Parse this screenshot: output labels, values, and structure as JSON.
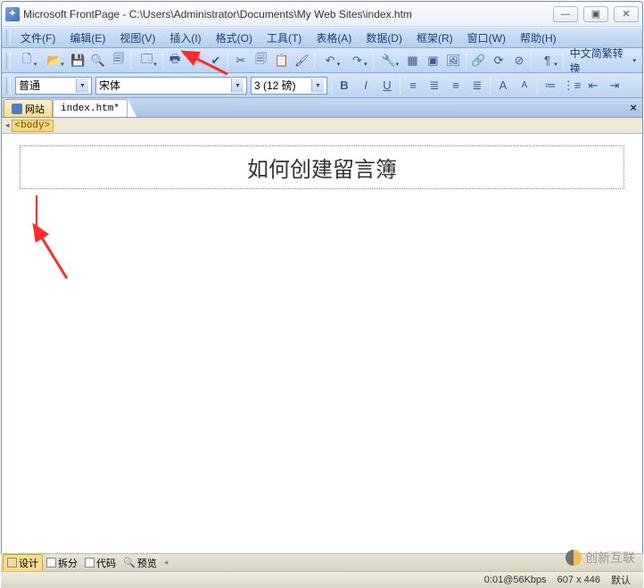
{
  "window": {
    "title": "Microsoft FrontPage - C:\\Users\\Administrator\\Documents\\My Web Sites\\index.htm",
    "min": "—",
    "max": "▣",
    "close": "✕"
  },
  "menu": {
    "file": "文件(F)",
    "edit": "编辑(E)",
    "view": "视图(V)",
    "insert": "插入(I)",
    "format": "格式(O)",
    "tools": "工具(T)",
    "table": "表格(A)",
    "data": "数据(D)",
    "frame": "框架(R)",
    "window": "窗口(W)",
    "help": "帮助(H)"
  },
  "toolbar": {
    "convert_label": "中文简繁转换"
  },
  "format": {
    "style": "普通",
    "font": "宋体",
    "size": "3 (12 磅)"
  },
  "tabs": {
    "site": "网站",
    "file": "index.htm*"
  },
  "tagstrip": {
    "body": "<body>"
  },
  "document": {
    "heading": "如何创建留言簿"
  },
  "viewbar": {
    "design": "设计",
    "split": "拆分",
    "code": "代码",
    "preview": "预览"
  },
  "status": {
    "speed": "0:01@56Kbps",
    "dims": "607 x 446",
    "mode": "默认"
  },
  "watermark": {
    "text": "创新互联"
  }
}
